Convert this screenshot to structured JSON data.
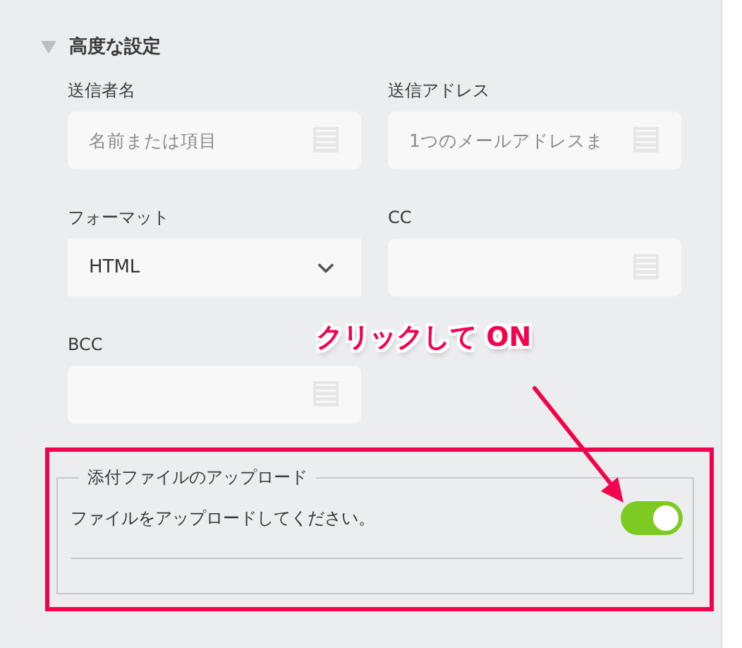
{
  "section": {
    "title": "高度な設定",
    "expanded": true
  },
  "fields": [
    {
      "kind": "text",
      "label": "送信者名",
      "placeholder": "名前または項目"
    },
    {
      "kind": "text",
      "label": "送信アドレス",
      "placeholder": "1つのメールアドレスま"
    },
    {
      "kind": "select",
      "label": "フォーマット",
      "value": "HTML"
    },
    {
      "kind": "text",
      "label": "CC"
    },
    {
      "kind": "text",
      "label": "BCC"
    }
  ],
  "attachment": {
    "legend": "添付ファイルのアップロード",
    "label": "ファイルをアップロードしてください。",
    "on": true
  },
  "annotation": {
    "text": "クリックして ON"
  }
}
